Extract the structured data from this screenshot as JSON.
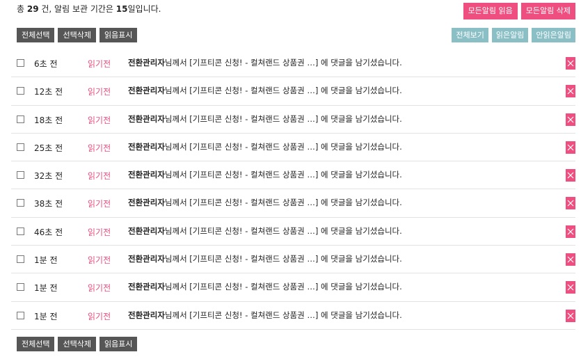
{
  "summary": {
    "prefix": "총 ",
    "count": "29",
    "middle": " 건, 알림 보관 기간은 ",
    "days": "15",
    "suffix": "일입니다."
  },
  "top_buttons": {
    "read_all": "모든알림 읽음",
    "delete_all": "모든알림 삭제"
  },
  "toolbar": {
    "select_all": "전체선택",
    "delete_selected": "선택삭제",
    "mark_read": "읽음표시"
  },
  "filters": {
    "all": "전체보기",
    "read": "읽은알림",
    "unread": "안읽은알림"
  },
  "notifications": [
    {
      "time": "6초 전",
      "state": "읽기전",
      "sender": "전환관리자",
      "text": "님께서 [기프티콘 신청! - 컬쳐랜드 상품권 …] 에 댓글을 남기셨습니다."
    },
    {
      "time": "12초 전",
      "state": "읽기전",
      "sender": "전환관리자",
      "text": "님께서 [기프티콘 신청! - 컬쳐랜드 상품권 …] 에 댓글을 남기셨습니다."
    },
    {
      "time": "18초 전",
      "state": "읽기전",
      "sender": "전환관리자",
      "text": "님께서 [기프티콘 신청! - 컬쳐랜드 상품권 …] 에 댓글을 남기셨습니다."
    },
    {
      "time": "25초 전",
      "state": "읽기전",
      "sender": "전환관리자",
      "text": "님께서 [기프티콘 신청! - 컬쳐랜드 상품권 …] 에 댓글을 남기셨습니다."
    },
    {
      "time": "32초 전",
      "state": "읽기전",
      "sender": "전환관리자",
      "text": "님께서 [기프티콘 신청! - 컬쳐랜드 상품권 …] 에 댓글을 남기셨습니다."
    },
    {
      "time": "38초 전",
      "state": "읽기전",
      "sender": "전환관리자",
      "text": "님께서 [기프티콘 신청! - 컬쳐랜드 상품권 …] 에 댓글을 남기셨습니다."
    },
    {
      "time": "46초 전",
      "state": "읽기전",
      "sender": "전환관리자",
      "text": "님께서 [기프티콘 신청! - 컬쳐랜드 상품권 …] 에 댓글을 남기셨습니다."
    },
    {
      "time": "1분 전",
      "state": "읽기전",
      "sender": "전환관리자",
      "text": "님께서 [기프티콘 신청! - 컬쳐랜드 상품권 …] 에 댓글을 남기셨습니다."
    },
    {
      "time": "1분 전",
      "state": "읽기전",
      "sender": "전환관리자",
      "text": "님께서 [기프티콘 신청! - 컬쳐랜드 상품권 …] 에 댓글을 남기셨습니다."
    },
    {
      "time": "1분 전",
      "state": "읽기전",
      "sender": "전환관리자",
      "text": "님께서 [기프티콘 신청! - 컬쳐랜드 상품권 …] 에 댓글을 남기셨습니다."
    }
  ],
  "colors": {
    "accent_pink": "#ee4f80",
    "filter_teal": "#8bbfc6",
    "toolbar_dark": "#565656"
  },
  "icons": {
    "delete": "close-icon"
  }
}
